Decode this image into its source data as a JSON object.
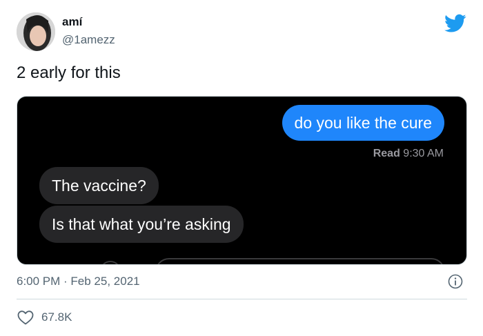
{
  "author": {
    "display_name": "amí",
    "handle": "@1amezz"
  },
  "tweet": {
    "text": "2 early for this",
    "timestamp": "6:00 PM · Feb 25, 2021"
  },
  "screenshot": {
    "outgoing": "do you like the cure",
    "read_label": "Read",
    "read_time": "9:30 AM",
    "incoming": [
      "The vaccine?",
      "Is that what you’re asking"
    ]
  },
  "engagement": {
    "likes": "67.8K"
  },
  "colors": {
    "twitter_blue": "#1d9bf0",
    "imessage_blue": "#1f86fb",
    "incoming_bubble": "#262628"
  },
  "icons": [
    "twitter-bird-icon",
    "info-icon",
    "heart-icon"
  ]
}
